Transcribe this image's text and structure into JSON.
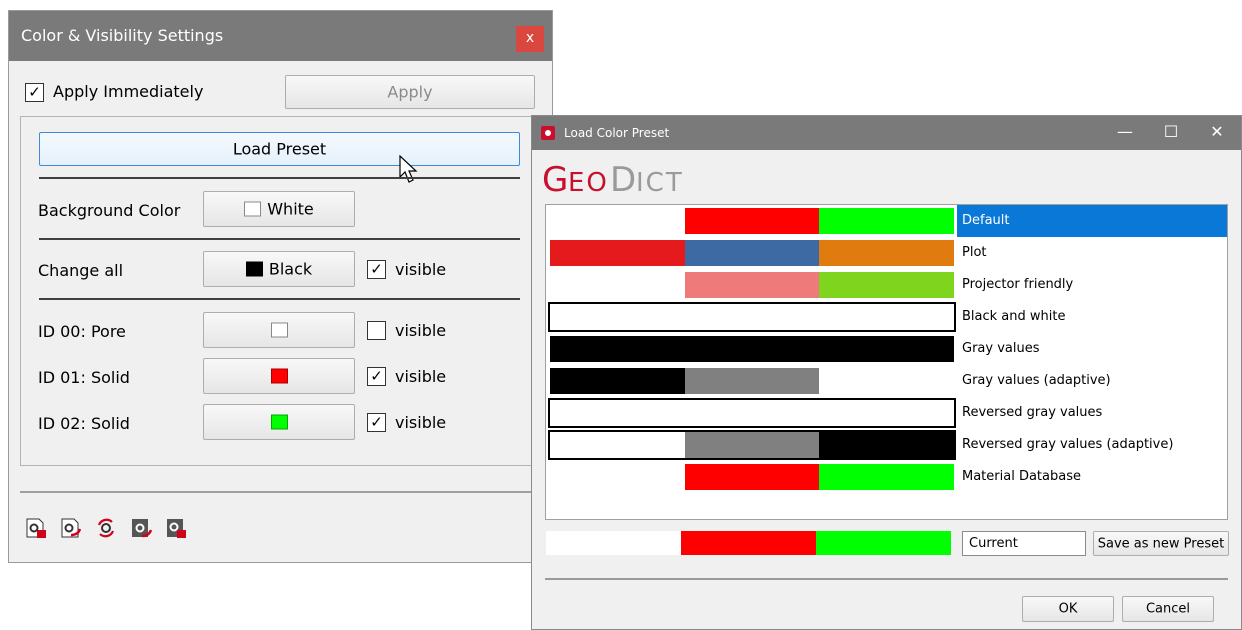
{
  "settings_window": {
    "title": "Color & Visibility Settings",
    "close_label": "x",
    "apply_immediately_label": "Apply Immediately",
    "apply_immediately_checked": true,
    "apply_button": "Apply",
    "load_preset_button": "Load Preset",
    "background_color_label": "Background Color",
    "background_color_value": "White",
    "change_all_label": "Change all",
    "change_all_value": "Black",
    "change_all_visible_label": "visible",
    "ids": [
      {
        "label": "ID 00: Pore",
        "color": "#ffffff",
        "visible_label": "visible",
        "visible": false
      },
      {
        "label": "ID 01: Solid",
        "color": "#ff0000",
        "visible_label": "visible",
        "visible": true
      },
      {
        "label": "ID 02: Solid",
        "color": "#00ff00",
        "visible_label": "visible",
        "visible": true
      }
    ],
    "toolbar_icons": [
      "gear-save-icon",
      "gear-export-icon",
      "gear-refresh-icon",
      "gear-import-icon",
      "gear-delete-icon"
    ]
  },
  "preset_dialog": {
    "title": "Load Color Preset",
    "logo_part1": "GeoDict",
    "minimize_label": "—",
    "maximize_label": "☐",
    "close_label": "✕",
    "presets": [
      {
        "name": "Default",
        "selected": true,
        "colors": [
          "#ffffff",
          "#ff0000",
          "#00ff00"
        ],
        "outline": false
      },
      {
        "name": "Plot",
        "selected": false,
        "colors": [
          "#e41a1c",
          "#3e6aa3",
          "#e07b10"
        ],
        "outline": false
      },
      {
        "name": "Projector friendly",
        "selected": false,
        "colors": [
          "#ffffff",
          "#ef7a7a",
          "#7fd41e"
        ],
        "outline": false
      },
      {
        "name": "Black and white",
        "selected": false,
        "colors": [
          "#ffffff",
          "#ffffff",
          "#ffffff"
        ],
        "outline": true
      },
      {
        "name": "Gray values",
        "selected": false,
        "colors": [
          "#000000",
          "#000000",
          "#000000"
        ],
        "outline": false
      },
      {
        "name": "Gray values (adaptive)",
        "selected": false,
        "colors": [
          "#000000",
          "#808080",
          "#ffffff"
        ],
        "outline": false
      },
      {
        "name": "Reversed gray values",
        "selected": false,
        "colors": [
          "#ffffff",
          "#ffffff",
          "#ffffff"
        ],
        "outline": true
      },
      {
        "name": "Reversed gray values (adaptive)",
        "selected": false,
        "colors": [
          "#ffffff",
          "#808080",
          "#000000"
        ],
        "outline": true
      },
      {
        "name": "Material Database",
        "selected": false,
        "colors": [
          "#ffffff",
          "#ff0000",
          "#00ff00"
        ],
        "outline": false
      }
    ],
    "current_colors": [
      "#ffffff",
      "#ff0000",
      "#00ff00"
    ],
    "current_field_value": "Current",
    "save_preset_button": "Save as new Preset",
    "ok_button": "OK",
    "cancel_button": "Cancel"
  },
  "colors": {
    "titlebar": "#7a7a7a",
    "close_red": "#d9473f",
    "selection_blue": "#0a78d7",
    "logo_red": "#c8102e"
  }
}
